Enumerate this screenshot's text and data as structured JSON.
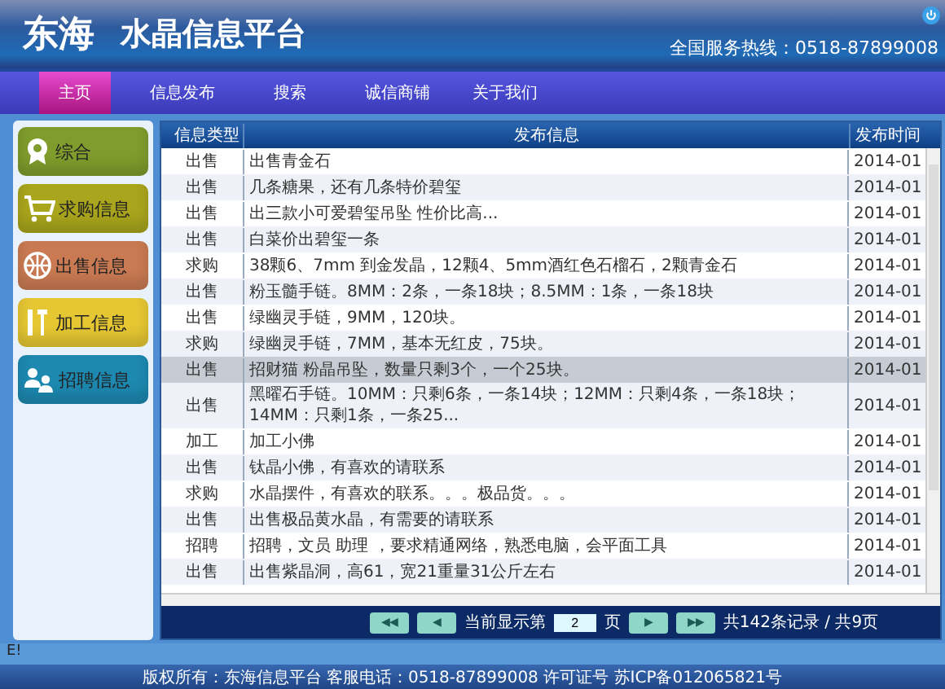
{
  "header": {
    "logo": "东海",
    "title": "水晶信息平台",
    "hotline": "全国服务热线：0518-87899008"
  },
  "nav": [
    {
      "label": "主页",
      "selected": true
    },
    {
      "label": "信息发布",
      "selected": false
    },
    {
      "label": "搜索",
      "selected": false
    },
    {
      "label": "诚信商铺",
      "selected": false
    },
    {
      "label": "关于我们",
      "selected": false
    }
  ],
  "sidebar": [
    {
      "label": "综合",
      "kind": "badge",
      "color": "#7f9c2c"
    },
    {
      "label": "求购信息",
      "kind": "cart",
      "color": "#a9a51c"
    },
    {
      "label": "出售信息",
      "kind": "ball",
      "color": "#c97a52"
    },
    {
      "label": "加工信息",
      "kind": "tools",
      "color": "#e5c633"
    },
    {
      "label": "招聘信息",
      "kind": "people",
      "color": "#1d88b0"
    }
  ],
  "table": {
    "columns": [
      "信息类型",
      "发布信息",
      "发布时间"
    ],
    "rows": [
      {
        "type": "出售",
        "info": "出售青金石",
        "time": "2014-01",
        "selected": false
      },
      {
        "type": "出售",
        "info": "几条糖果，还有几条特价碧玺",
        "time": "2014-01",
        "selected": false
      },
      {
        "type": "出售",
        "info": "出三款小可爱碧玺吊坠 性价比高...",
        "time": "2014-01",
        "selected": false
      },
      {
        "type": "出售",
        "info": "白菜价出碧玺一条",
        "time": "2014-01",
        "selected": false
      },
      {
        "type": "求购",
        "info": "38颗6、7mm 到金发晶，12颗4、5mm酒红色石榴石，2颗青金石",
        "time": "2014-01",
        "selected": false
      },
      {
        "type": "出售",
        "info": "粉玉髓手链。8MM：2条，一条18块；8.5MM：1条，一条18块",
        "time": "2014-01",
        "selected": false
      },
      {
        "type": "出售",
        "info": "绿幽灵手链，9MM，120块。",
        "time": "2014-01",
        "selected": false
      },
      {
        "type": "求购",
        "info": "绿幽灵手链，7MM，基本无红皮，75块。",
        "time": "2014-01",
        "selected": false
      },
      {
        "type": "出售",
        "info": "招财猫 粉晶吊坠，数量只剩3个，一个25块。",
        "time": "2014-01",
        "selected": true
      },
      {
        "type": "出售",
        "info": "黑曜石手链。10MM：只剩6条，一条14块；12MM：只剩4条，一条18块；14MM：只剩1条，一条25...",
        "time": "2014-01",
        "selected": false
      },
      {
        "type": "加工",
        "info": "加工小佛",
        "time": "2014-01",
        "selected": false
      },
      {
        "type": "出售",
        "info": "钛晶小佛，有喜欢的请联系",
        "time": "2014-01",
        "selected": false
      },
      {
        "type": "求购",
        "info": "水晶摆件，有喜欢的联系。。。极品货。。。",
        "time": "2014-01",
        "selected": false
      },
      {
        "type": "出售",
        "info": "出售极品黄水晶，有需要的请联系",
        "time": "2014-01",
        "selected": false
      },
      {
        "type": "招聘",
        "info": "招聘，文员 助理 ，要求精通网络，熟悉电脑，会平面工具",
        "time": "2014-01",
        "selected": false
      },
      {
        "type": "出售",
        "info": "出售紫晶洞，高61，宽21重量31公斤左右",
        "time": "2014-01",
        "selected": false
      }
    ]
  },
  "pager": {
    "first": "◀◀",
    "prev": "◀",
    "current_label": "当前显示第",
    "page": "2",
    "page_suffix": "页",
    "next": "▶",
    "last": "▶▶",
    "summary": "共142条记录 / 共9页"
  },
  "status_bar": "E!",
  "footer": "版权所有：东海信息平台 客服电话：0518-87899008 许可证号 苏ICP备012065821号"
}
